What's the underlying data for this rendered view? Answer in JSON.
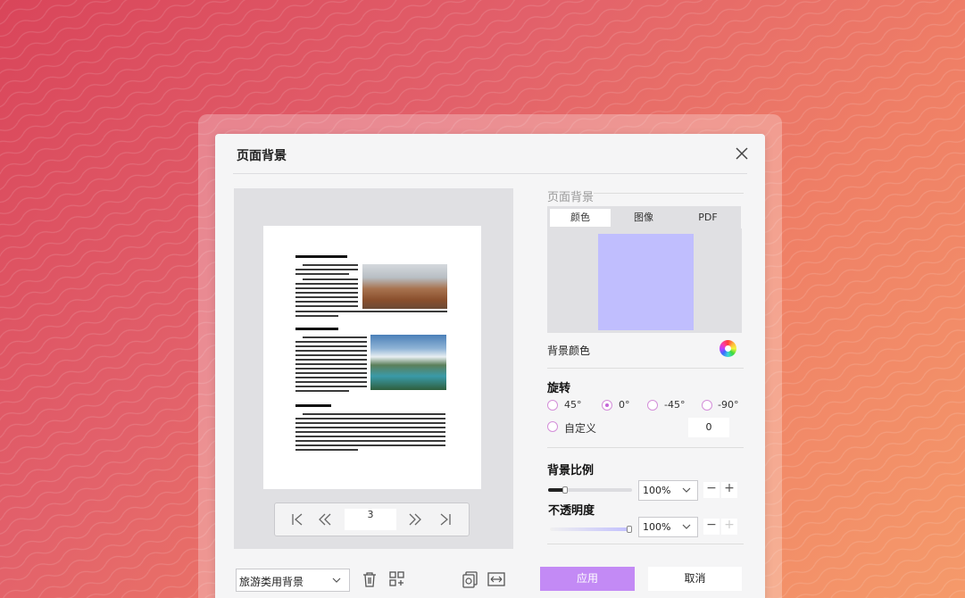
{
  "dialog": {
    "title": "页面背景"
  },
  "preview": {
    "page_number": "3",
    "doc_headings": [
      "",
      "",
      ""
    ]
  },
  "right": {
    "section_label": "页面背景",
    "tabs": [
      "颜色",
      "图像",
      "PDF"
    ],
    "active_tab": "颜色",
    "swatch_color": "#c0befe",
    "bg_color_label": "背景颜色",
    "rotation": {
      "label": "旋转",
      "options": [
        "45°",
        "0°",
        "-45°",
        "-90°"
      ],
      "selected": "0°",
      "custom_label": "自定义",
      "custom_value": "0"
    },
    "scale": {
      "label": "背景比例",
      "value": "100%",
      "level": 0.2
    },
    "opacity": {
      "label": "不透明度",
      "value": "100%",
      "level": 1.0
    }
  },
  "footer": {
    "preset_value": "旅游类用背景",
    "apply_label": "应用",
    "cancel_label": "取消"
  },
  "colors": {
    "accent": "#c38af5",
    "radio": "#d48fd9"
  }
}
